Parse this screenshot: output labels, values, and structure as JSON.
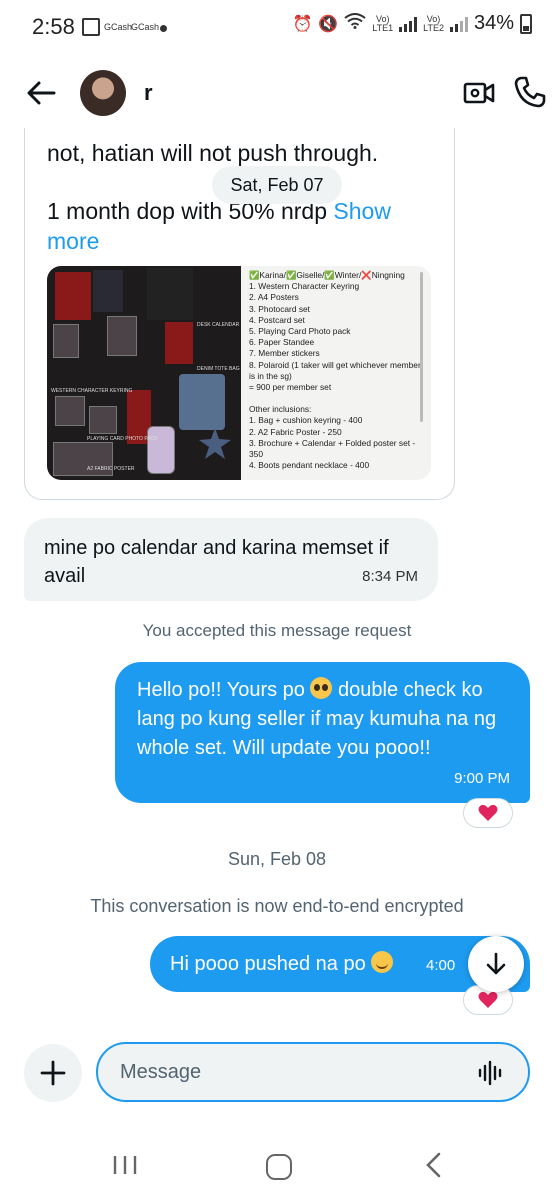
{
  "status_bar": {
    "time": "2:58",
    "notification_1": "GCash",
    "notification_2": "GCash",
    "sim1": "LTE1",
    "sim2": "LTE2",
    "volte1": "Vo)",
    "volte2": "Vo)",
    "battery": "34%"
  },
  "header": {
    "contact_name": "r",
    "icons": [
      "back-arrow-icon",
      "video-call-icon",
      "phone-icon"
    ]
  },
  "shared_post": {
    "text_line1": "not, hatian will not push through.",
    "text_line2": "1 month dop with 50% nrdp",
    "show_more": "Show more",
    "image_list": [
      "✅Karina/✅Giselle/✅Winter/❌Ningning",
      "1. Western Character Keyring",
      "2. A4 Posters",
      "3. Photocard set",
      "4. Postcard set",
      "5. Playing Card Photo pack",
      "6. Paper Standee",
      "7. Member stickers",
      "8. Polaroid (1 taker will get whichever member is in the sg)",
      "= 900 per member set",
      "",
      "Other inclusions:",
      "1. Bag + cushion keyring - 400",
      "2. A2 Fabric Poster - 250",
      "3. Brochure + Calendar + Folded poster set - 350",
      "4. Boots pendant necklace - 400"
    ],
    "image_labels": [
      "DESK CALENDAR",
      "WESTERN CHARACTER KEYRING",
      "PLAYING CARD PHOTO PACK",
      "A2 FABRIC POSTER",
      "DENIM TOTE BAG"
    ]
  },
  "date_sat": "Sat, Feb 07",
  "incoming_message": {
    "text": "mine po calendar and karina memset if avail",
    "time": "8:34 PM"
  },
  "system_accepted": "You accepted this message request",
  "outgoing_message_1": {
    "text_before": "Hello po!! Yours po",
    "text_after": "double check ko lang po kung seller if may kumuha na ng whole set. Will update you pooo!!",
    "time": "9:00 PM",
    "reaction": "heart"
  },
  "date_sun": "Sun, Feb 08",
  "system_encrypted": "This conversation is now end-to-end encrypted",
  "outgoing_message_2": {
    "text": "Hi pooo pushed na po",
    "time": "4:00",
    "reaction": "heart"
  },
  "composer": {
    "placeholder": "Message"
  },
  "colors": {
    "accent": "#1d9bf0",
    "bubble_incoming": "#eff3f4",
    "heart": "#e0245e"
  }
}
